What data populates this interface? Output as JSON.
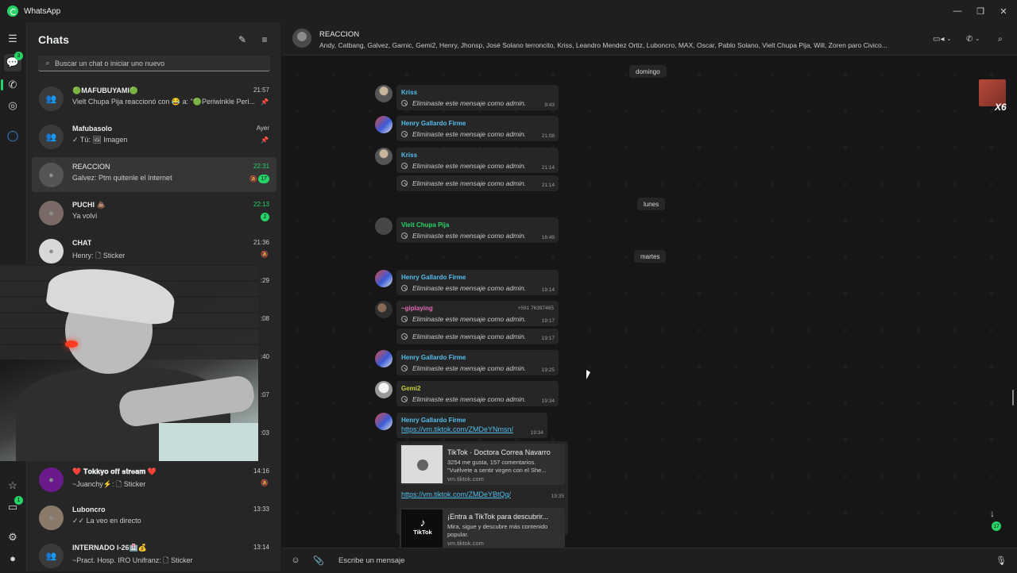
{
  "app": {
    "title": "WhatsApp"
  },
  "colors": {
    "accent": "#25d366",
    "link": "#53bdeb"
  },
  "rail": {
    "menu_icon": "hamburger-icon",
    "chats_badge": "3",
    "status_badge": "1"
  },
  "sidebar": {
    "title": "Chats",
    "search_placeholder": "Buscar un chat o iniciar uno nuevo",
    "chats": [
      {
        "name": "🟢MAFUBUYAMI🟢",
        "preview": "Vielt Chupa Pija reaccionó con 😂 a: \"🟢Periwinkle Peri...",
        "time": "21:57",
        "pinned": true
      },
      {
        "name": "Mafubasolo",
        "preview": "✓ Tú: 🖼 Imagen",
        "time": "Ayer",
        "pinned": true
      },
      {
        "name": "REACCION",
        "preview": "Galvez: Ptm quitenle el Internet",
        "time": "22:31",
        "unread": "17",
        "muted": true
      },
      {
        "name": "PUCHI 💩",
        "preview": "Ya volví",
        "time": "22:13",
        "unread": "2"
      },
      {
        "name": "CHAT",
        "preview": "Henry: 🗋 Sticker",
        "time": "21:36",
        "muted": true
      },
      {
        "name": "",
        "preview": "",
        "time": ":29"
      },
      {
        "name": "",
        "preview": "",
        "time": ":08"
      },
      {
        "name": "",
        "preview": "",
        "time": ":40"
      },
      {
        "name": "",
        "preview": "",
        "time": ":07"
      },
      {
        "name": "",
        "preview": "",
        "time": ":03"
      },
      {
        "name": "❤️ 𝐓𝐨𝐤𝐤𝐲𝐨 𝐨𝐟𝐟 𝐬𝐭𝐫𝐞𝐚𝐦 ❤️",
        "preview": "~Juanchy⚡: 🗋 Sticker",
        "time": "14:16",
        "muted": true
      },
      {
        "name": "Luboncro",
        "preview": "✓✓ La veo en directo",
        "time": "13:33"
      },
      {
        "name": "INTERNADO I-26🏥💰",
        "preview": "~Pract. Hosp. IRO Unifranz: 🗋 Sticker",
        "time": "13:14"
      }
    ]
  },
  "conversation": {
    "title": "REACCION",
    "members": "Andy, Catbang, Galvez, Garnic, Gemi2, Henry, Jhonsp, José Solano terroncito, Kriss, Leandro Mendez Ortiz, Luboncro, MAX, Oscar, Pablo Solano, Vielt Chupa Pija, Will, Zoren paro Civico...",
    "deleted_text": "Eliminaste este mensaje como admin.",
    "days": [
      "domingo",
      "lunes",
      "martes"
    ],
    "messages": [
      {
        "sender": "Kriss",
        "color": "#53bdeb",
        "lines": [
          {
            "time": "8:43"
          }
        ]
      },
      {
        "sender": "Henry Gallardo Firme",
        "color": "#53bdeb",
        "lines": [
          {
            "time": "21:08"
          }
        ]
      },
      {
        "sender": "Kriss",
        "color": "#53bdeb",
        "lines": [
          {
            "time": "21:14"
          },
          {
            "time": "21:14"
          }
        ]
      },
      {
        "sender": "Vielt Chupa Pija",
        "color": "#25d366",
        "lines": [
          {
            "time": "16:49"
          }
        ]
      },
      {
        "sender": "Henry Gallardo Firme",
        "color": "#53bdeb",
        "lines": [
          {
            "time": "19:14"
          }
        ]
      },
      {
        "sender": "~giplaying",
        "color": "#e26ab6",
        "phone": "+591 76397465",
        "lines": [
          {
            "time": "19:17"
          },
          {
            "time": "19:17"
          }
        ]
      },
      {
        "sender": "Henry Gallardo Firme",
        "color": "#53bdeb",
        "lines": [
          {
            "time": "19:25"
          }
        ]
      },
      {
        "sender": "Gemi2",
        "color": "#c9cf3a",
        "lines": [
          {
            "time": "19:34"
          }
        ]
      }
    ],
    "link_message": {
      "sender": "Henry Gallardo Firme",
      "link1": "https://vm.tiktok.com/ZMDeYNmsn/",
      "time1": "19:34",
      "card1": {
        "title": "TikTok · Doctora Correa Navarro",
        "desc": "3254 me gusta, 157 comentarios. \"Vuélvete a sentir virgen con el She...",
        "domain": "vm.tiktok.com"
      },
      "link2": "https://vm.tiktok.com/ZMDeYBtQq/",
      "time2": "19:35",
      "card2": {
        "title": "¡Entra a TikTok para descubrir...",
        "desc": "Mira, sigue y descubre más contenido popular.",
        "domain": "vm.tiktok.com",
        "logo_text": "TikTok"
      }
    },
    "sticker_label": "X6",
    "scroll_badge": "17"
  },
  "composer": {
    "placeholder": "Escribe un mensaje"
  }
}
